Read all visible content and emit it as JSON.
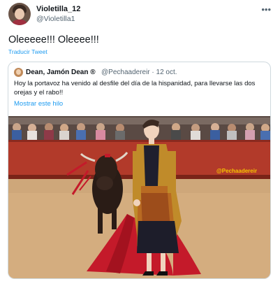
{
  "tweet": {
    "display_name": "Violetilla_12",
    "handle": "@Violetilla1",
    "text": "Oleeeee!!! Oleeee!!!",
    "translate_label": "Traducir Tweet"
  },
  "quoted": {
    "display_name": "Dean, Jamón Dean ®",
    "meta": "@Pechaadereir · 12 oct.",
    "text": "Hoy la portavoz ha venido al desfile del día de la hispanidad, para llevarse las dos orejas y el rabo!!",
    "show_thread_label": "Mostrar este hilo",
    "image_watermark": "@Pechaadereir"
  },
  "icons": {
    "more": "more-horizontal-icon",
    "avatar": "user-avatar",
    "quoted_avatar": "quoted-user-avatar"
  },
  "colors": {
    "link": "#1d9bf0",
    "secondary_text": "#536471",
    "border": "#cfd9de",
    "cape_red": "#c41a2a",
    "arena_sand": "#d4ad7f",
    "barrier_red": "#b23a2a"
  }
}
